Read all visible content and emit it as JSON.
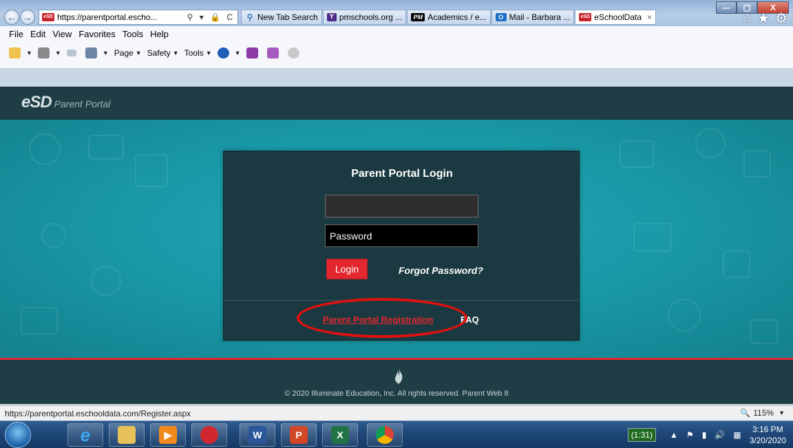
{
  "browser": {
    "address": {
      "host": "https://parentportal.escho...",
      "favicon": "eSD",
      "icons": "⚲ ▾ 🔒 C"
    },
    "tabs": [
      {
        "label": "New Tab Search",
        "favicon": "⚲",
        "icon": "search-icon"
      },
      {
        "label": "pmschools.org ...",
        "favicon": "Y",
        "icon": "yahoo-icon"
      },
      {
        "label": "Academics / e...",
        "favicon": "PM",
        "icon": "pm-icon"
      },
      {
        "label": "Mail - Barbara ...",
        "favicon": "O",
        "icon": "outlook-icon"
      },
      {
        "label": "eSchoolData",
        "favicon": "eSD",
        "icon": "esd-icon",
        "close": "×"
      }
    ],
    "window_controls": [
      "—",
      "▢",
      "X"
    ],
    "menu": [
      "File",
      "Edit",
      "View",
      "Favorites",
      "Tools",
      "Help"
    ],
    "command_bar": [
      {
        "label": "",
        "icon": "home-icon"
      },
      {
        "label": "",
        "icon": "rss-feed-icon"
      },
      {
        "label": "",
        "icon": "read-mail-icon"
      },
      {
        "label": "",
        "icon": "print-icon"
      },
      {
        "label": "Page",
        "icon": "page-menu"
      },
      {
        "label": "Safety",
        "icon": "safety-menu"
      },
      {
        "label": "Tools",
        "icon": "tools-menu"
      },
      {
        "label": "",
        "icon": "help-icon"
      },
      {
        "label": "",
        "icon": "onenote-icon"
      },
      {
        "label": "",
        "icon": "onenote-linked-icon"
      },
      {
        "label": "",
        "icon": "settings-gear-icon"
      }
    ]
  },
  "portal": {
    "logo_mark": "eSD",
    "logo_text": "Parent Portal",
    "login": {
      "title": "Parent Portal Login",
      "username_value": "",
      "password_placeholder": "Password",
      "login_button": "Login",
      "forgot_password": "Forgot Password?",
      "registration_link": "Parent Portal Registration",
      "faq_link": "FAQ"
    },
    "footer": {
      "copyright": "© 2020 Illuminate Education, Inc. All rights reserved. Parent Web 8"
    }
  },
  "status_bar": {
    "url": "https://parentportal.eschooldata.com/Register.aspx",
    "zoom": "115%",
    "zoom_icon": "magnifier-icon"
  },
  "taskbar": {
    "apps": [
      "internet-explorer",
      "file-explorer",
      "media-player",
      "security-app",
      "word",
      "powerpoint",
      "excel",
      "chrome"
    ],
    "battery": "(1:31)",
    "time": "3:16 PM",
    "date": "3/20/2020"
  },
  "colors": {
    "accent_red": "#e3272f",
    "header_teal": "#1f3d45",
    "bg_teal": "#1a9aa8",
    "panel": "#1b3940"
  }
}
